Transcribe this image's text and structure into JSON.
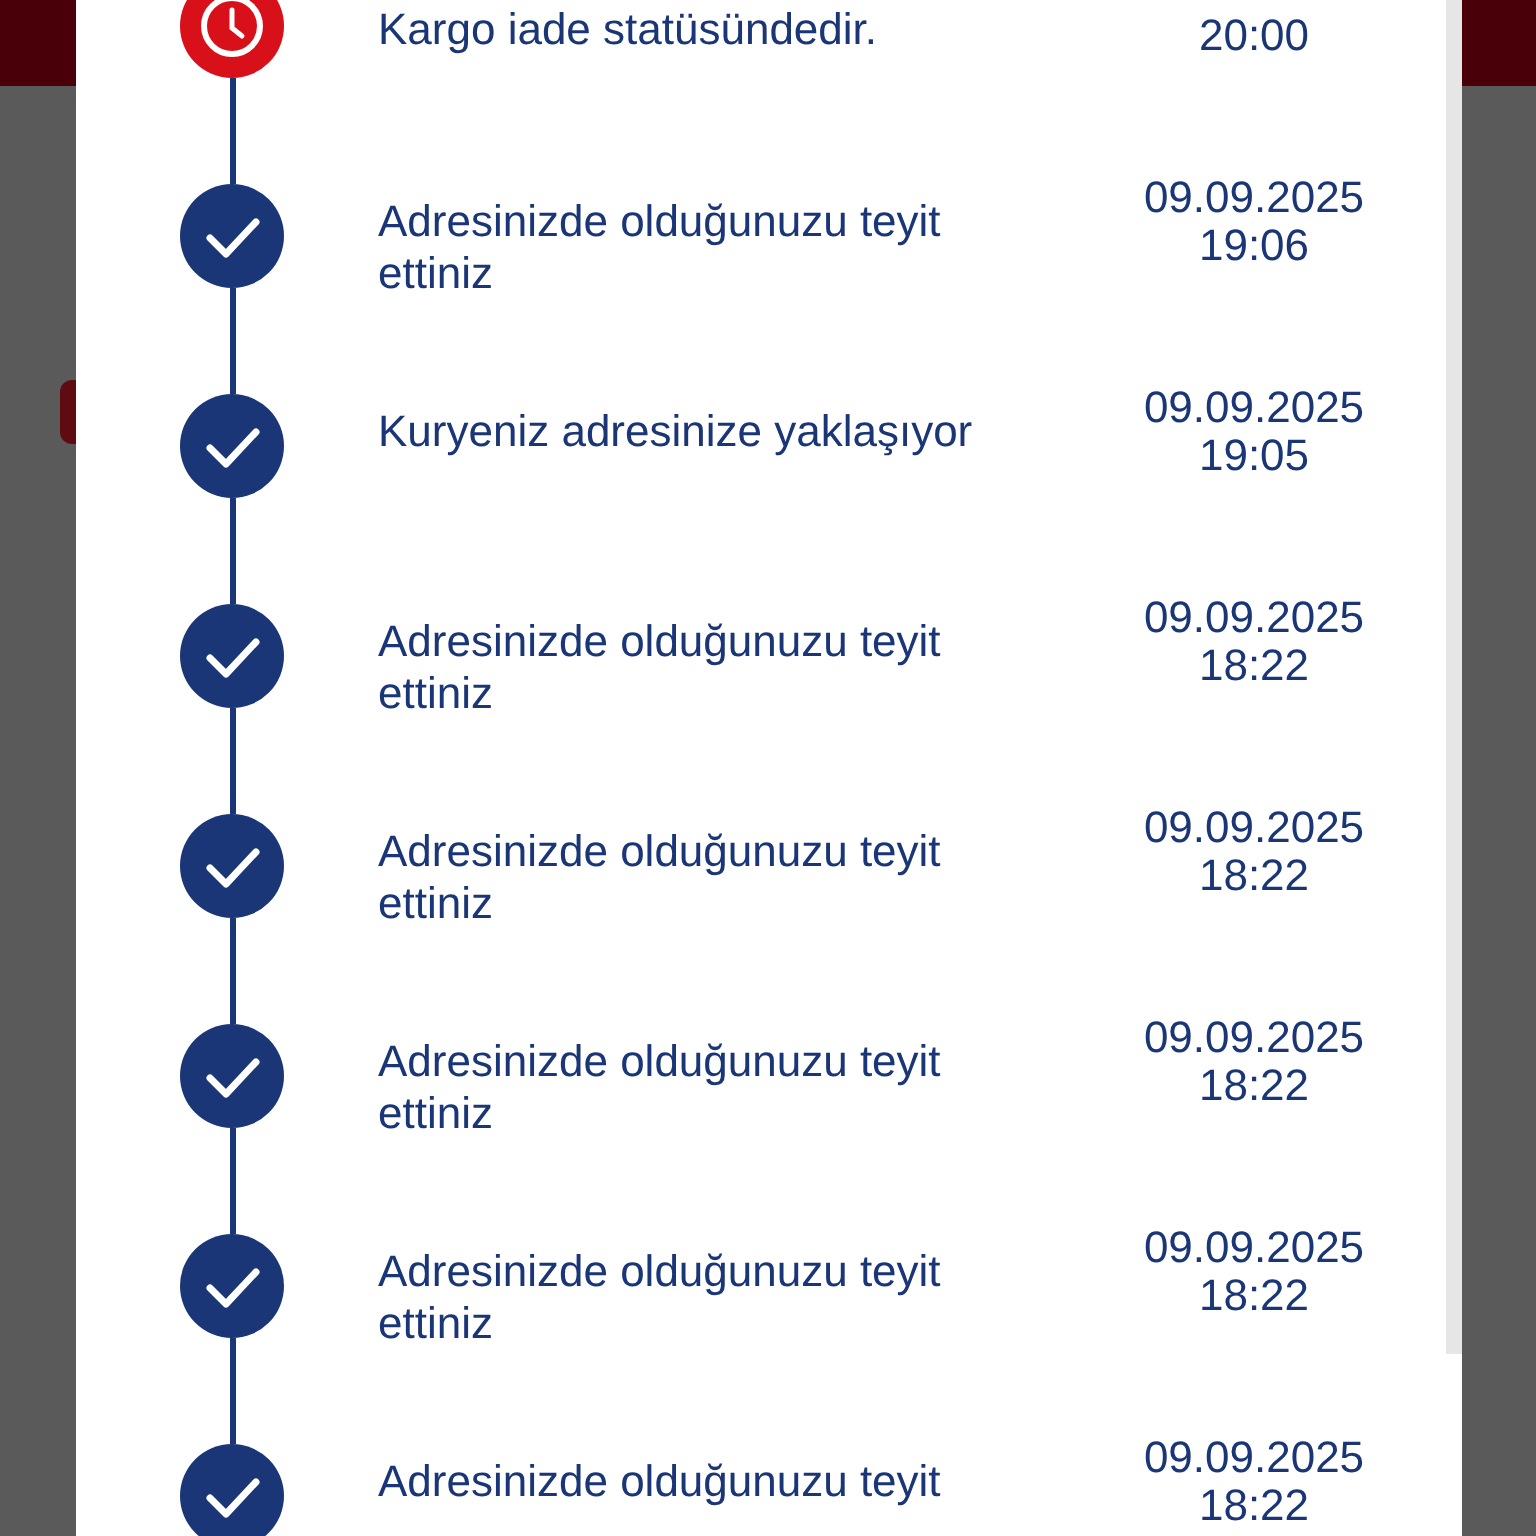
{
  "tracking_events": [
    {
      "kind": "pending",
      "text": "Kargo iade statüsündedir.",
      "time": "20:00"
    },
    {
      "kind": "done",
      "text": "Adresinizde olduğunuzu teyit ettiniz",
      "date": "09.09.2025",
      "time": "19:06"
    },
    {
      "kind": "done",
      "text": "Kuryeniz adresinize yaklaşıyor",
      "date": "09.09.2025",
      "time": "19:05"
    },
    {
      "kind": "done",
      "text": "Adresinizde olduğunuzu teyit ettiniz",
      "date": "09.09.2025",
      "time": "18:22"
    },
    {
      "kind": "done",
      "text": "Adresinizde olduğunuzu teyit ettiniz",
      "date": "09.09.2025",
      "time": "18:22"
    },
    {
      "kind": "done",
      "text": "Adresinizde olduğunuzu teyit ettiniz",
      "date": "09.09.2025",
      "time": "18:22"
    },
    {
      "kind": "done",
      "text": "Adresinizde olduğunuzu teyit ettiniz",
      "date": "09.09.2025",
      "time": "18:22"
    },
    {
      "kind": "done",
      "text": "Adresinizde olduğunuzu teyit",
      "date": "09.09.2025",
      "time": "18:22"
    }
  ]
}
